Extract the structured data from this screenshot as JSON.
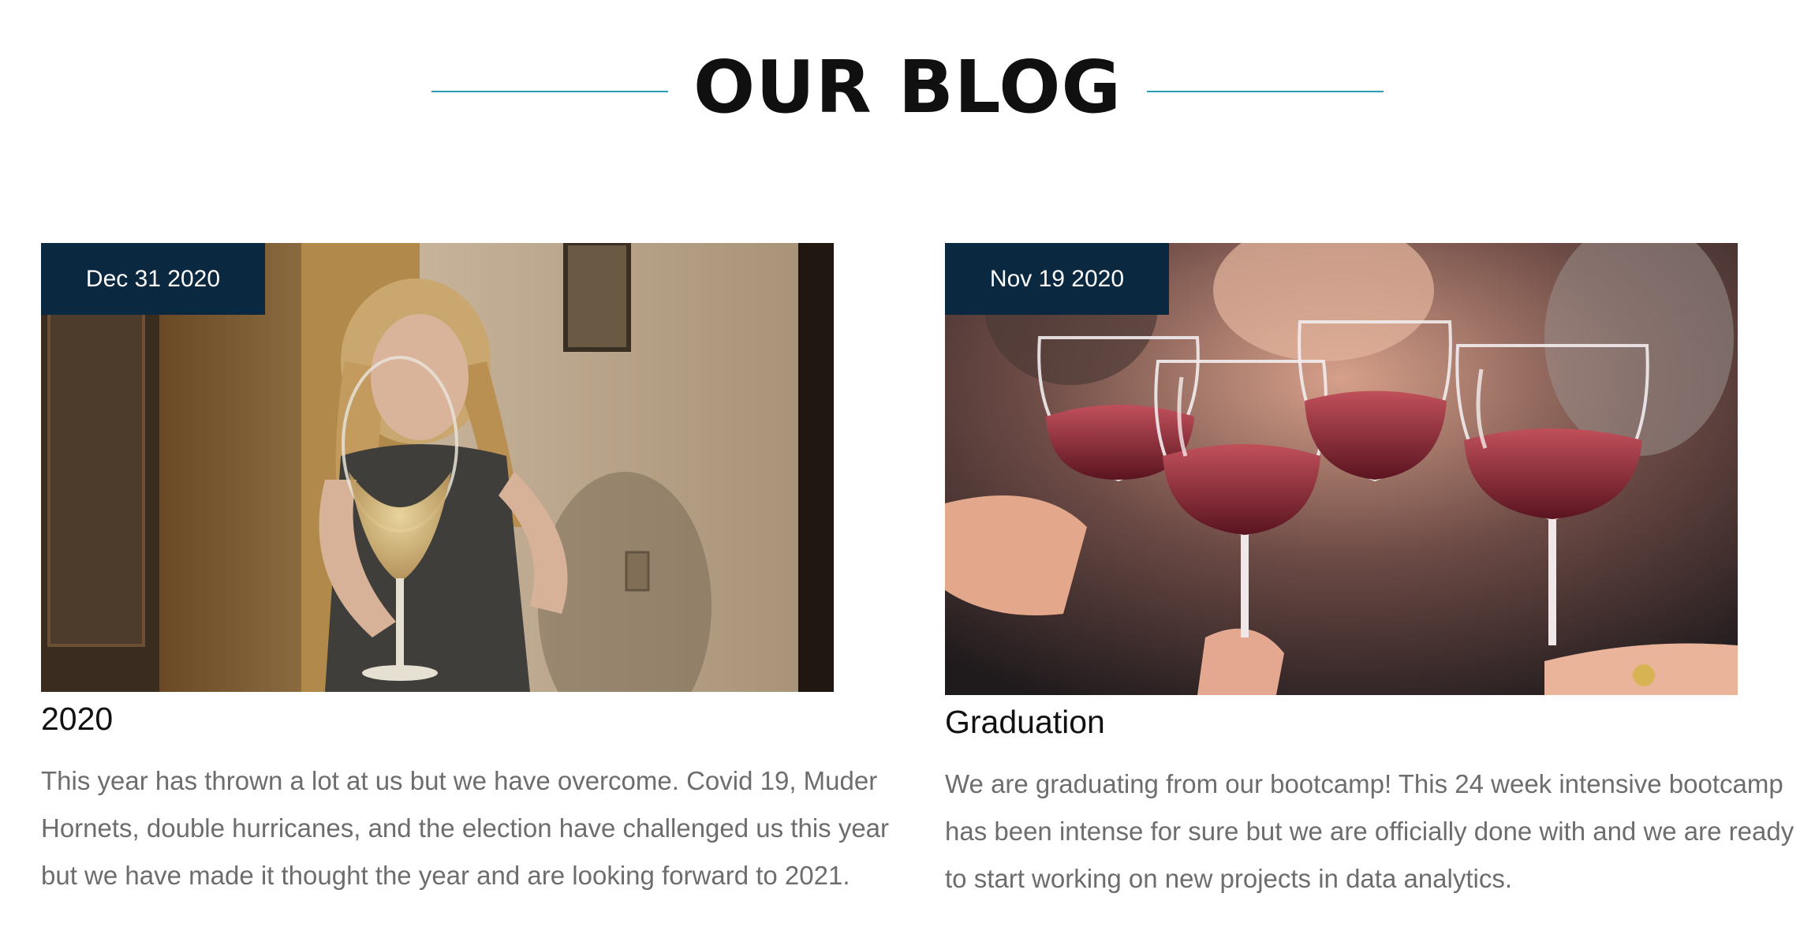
{
  "heading": {
    "title": "OUR BLOG"
  },
  "posts": [
    {
      "date": "Dec 31 2020",
      "title": "2020",
      "body": "This year has thrown a lot at us but we have overcome. Covid 19, Muder Hornets, double hurricanes, and the election have challenged us this year but we have made it thought the year and are looking forward to 2021."
    },
    {
      "date": "Nov 19 2020",
      "title": "Graduation",
      "body": "We are graduating from our bootcamp! This 24 week intensive bootcamp has been intense for sure but we are officially done with and we are ready to start working on new projects in data analytics."
    }
  ],
  "colors": {
    "accent_rule": "#2a9fb4",
    "badge_bg": "#0a2941",
    "body_text": "#6d6d6d"
  }
}
